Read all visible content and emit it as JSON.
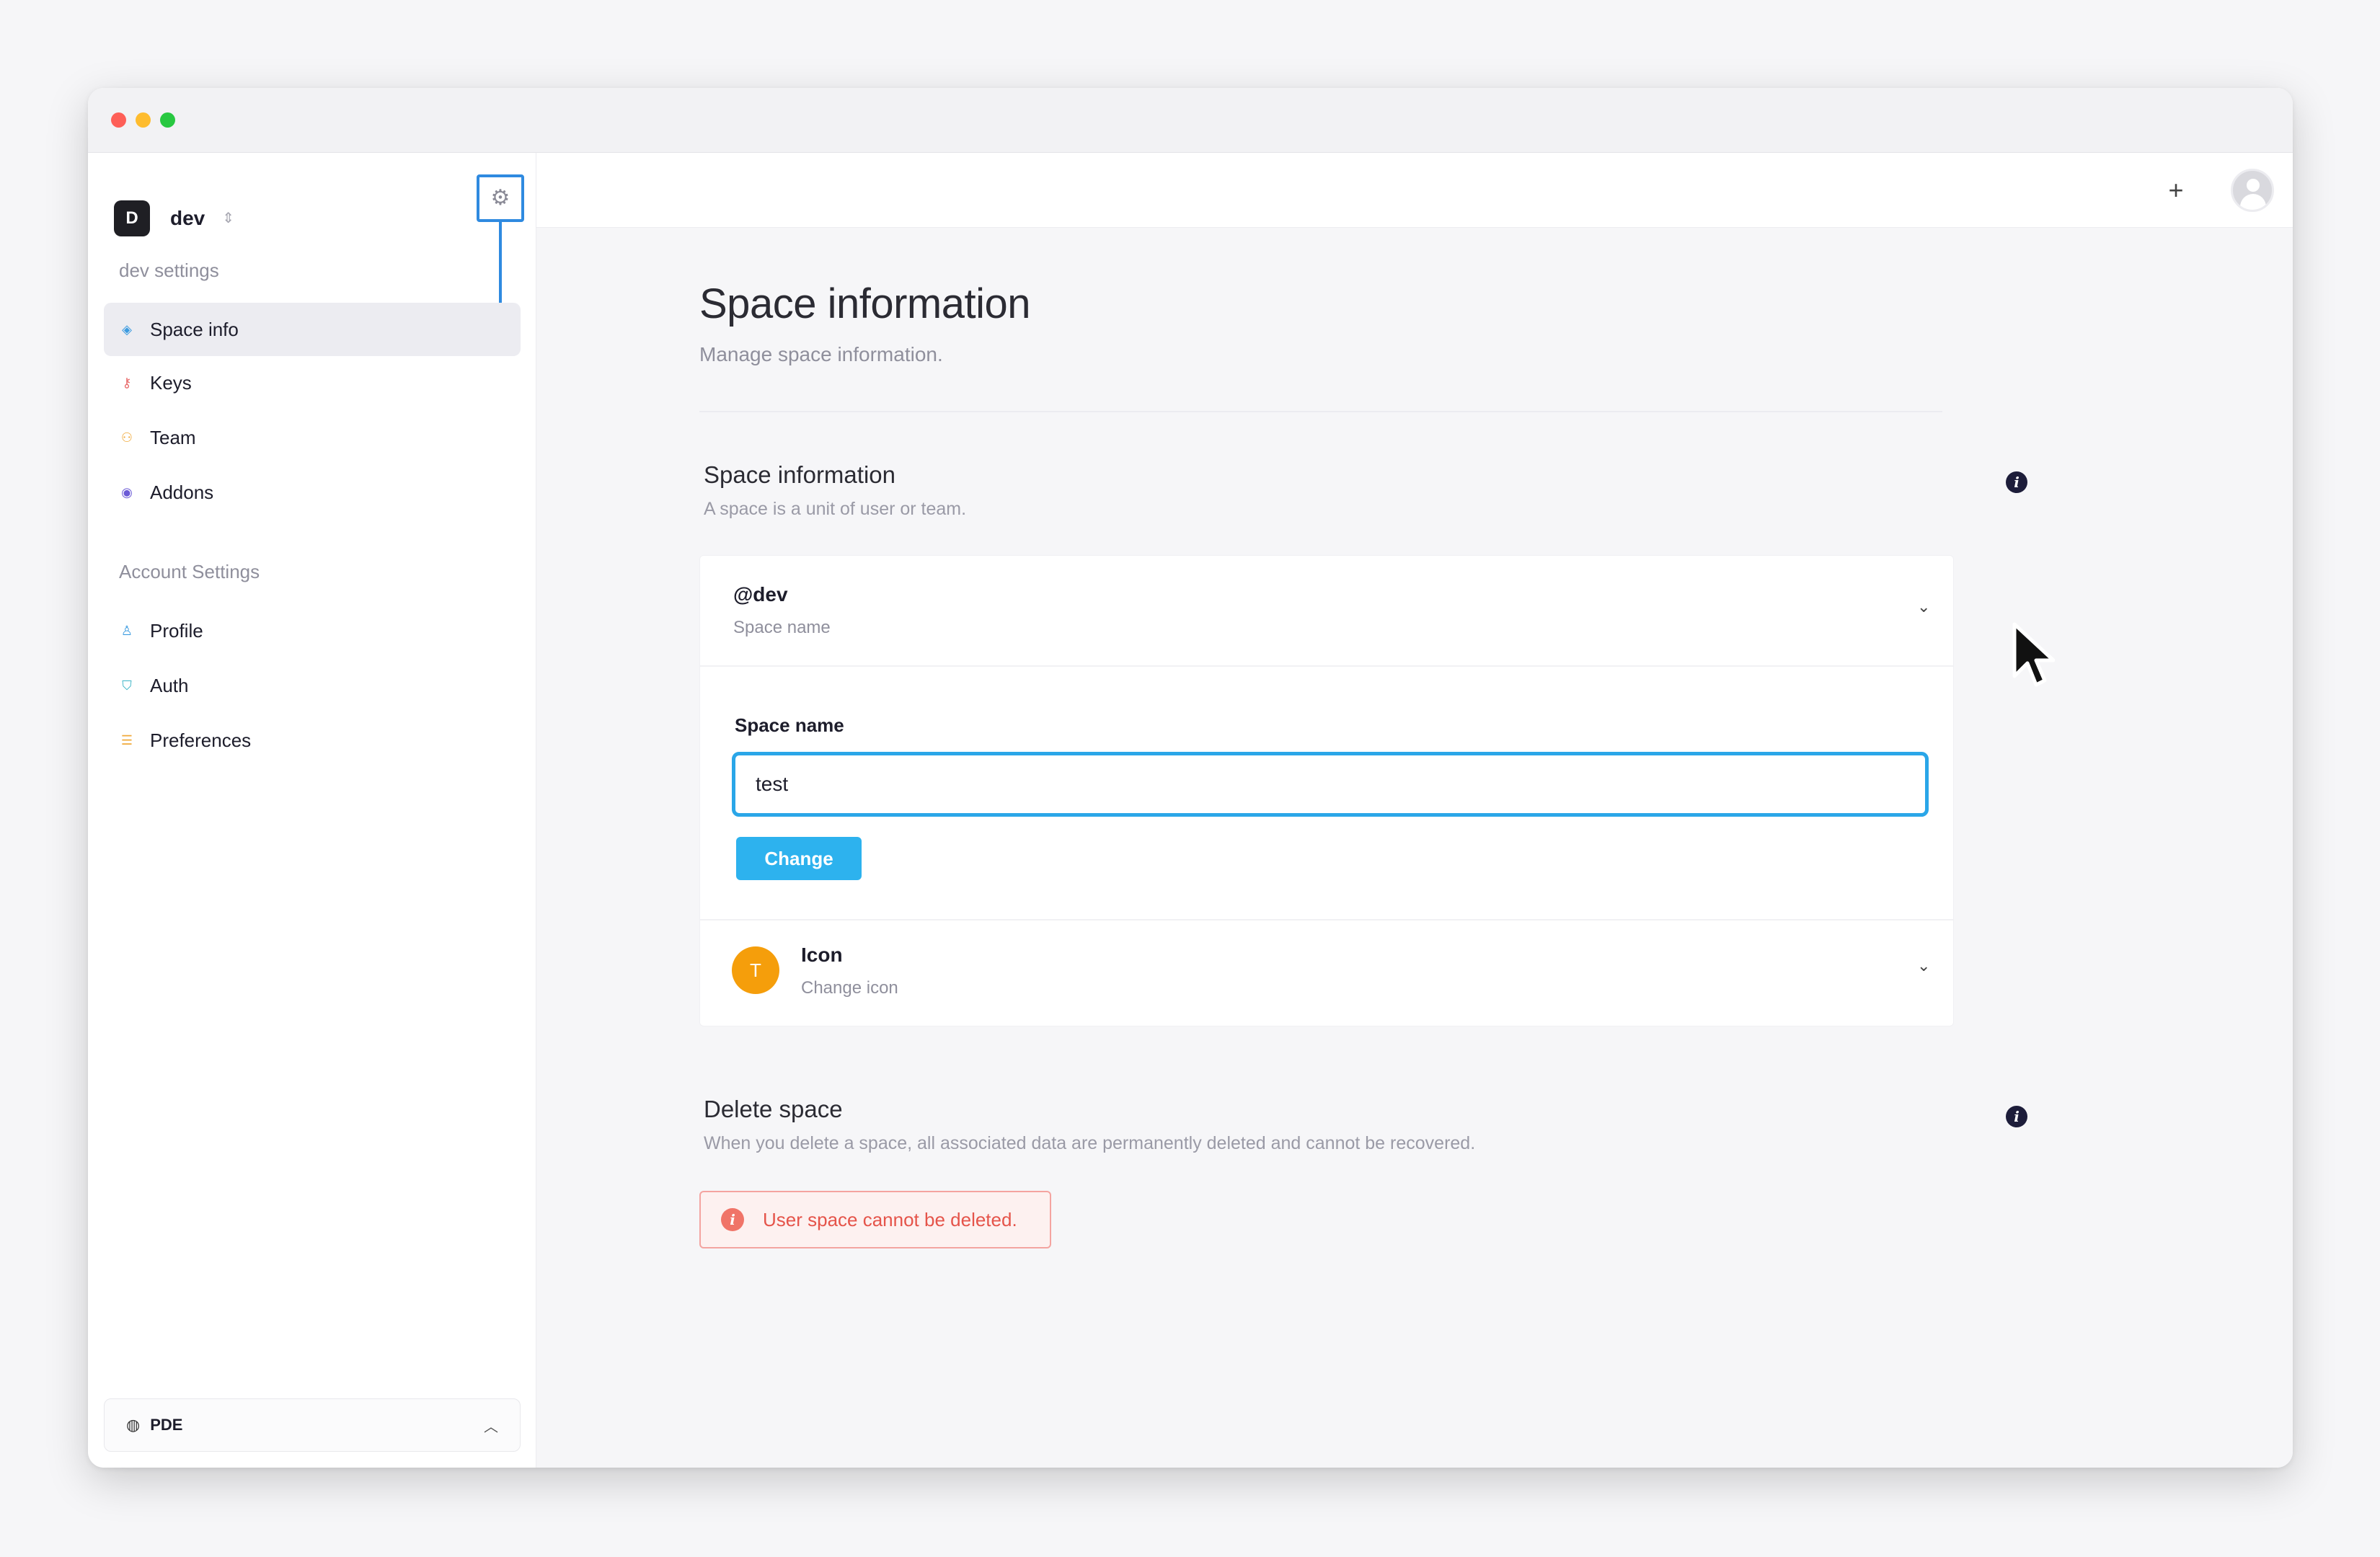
{
  "colors": {
    "accent": "#2f8ae0",
    "input_focus": "#2aa6e8",
    "primary_button": "#2db2ee",
    "alert_text": "#e5544a",
    "icon_avatar": "#f59e0b"
  },
  "workspace": {
    "avatar_letter": "D",
    "name": "dev"
  },
  "sidebar": {
    "section1_label": "dev settings",
    "section1_items": [
      {
        "label": "Space info",
        "icon": "layers-icon",
        "active": true
      },
      {
        "label": "Keys",
        "icon": "key-icon",
        "active": false
      },
      {
        "label": "Team",
        "icon": "team-icon",
        "active": false
      },
      {
        "label": "Addons",
        "icon": "addon-icon",
        "active": false
      }
    ],
    "section2_label": "Account Settings",
    "section2_items": [
      {
        "label": "Profile",
        "icon": "user-icon",
        "active": false
      },
      {
        "label": "Auth",
        "icon": "shield-icon",
        "active": false
      },
      {
        "label": "Preferences",
        "icon": "sliders-icon",
        "active": false
      }
    ],
    "footer": {
      "label": "PDE",
      "icon": "pde-icon"
    }
  },
  "main": {
    "title": "Space information",
    "subtitle": "Manage space information.",
    "space_section": {
      "title": "Space information",
      "subtitle": "A space is a unit of user or team."
    },
    "space_name_row": {
      "title": "@dev",
      "subtitle": "Space name"
    },
    "space_name_form": {
      "label": "Space name",
      "value": "test",
      "button_label": "Change"
    },
    "icon_row": {
      "avatar_letter": "T",
      "title": "Icon",
      "subtitle": "Change icon"
    },
    "delete_section": {
      "title": "Delete space",
      "subtitle": "When you delete a space, all associated data are permanently deleted and cannot be recovered.",
      "alert": "User space cannot be deleted."
    }
  },
  "topbar": {
    "add_label": "+"
  }
}
